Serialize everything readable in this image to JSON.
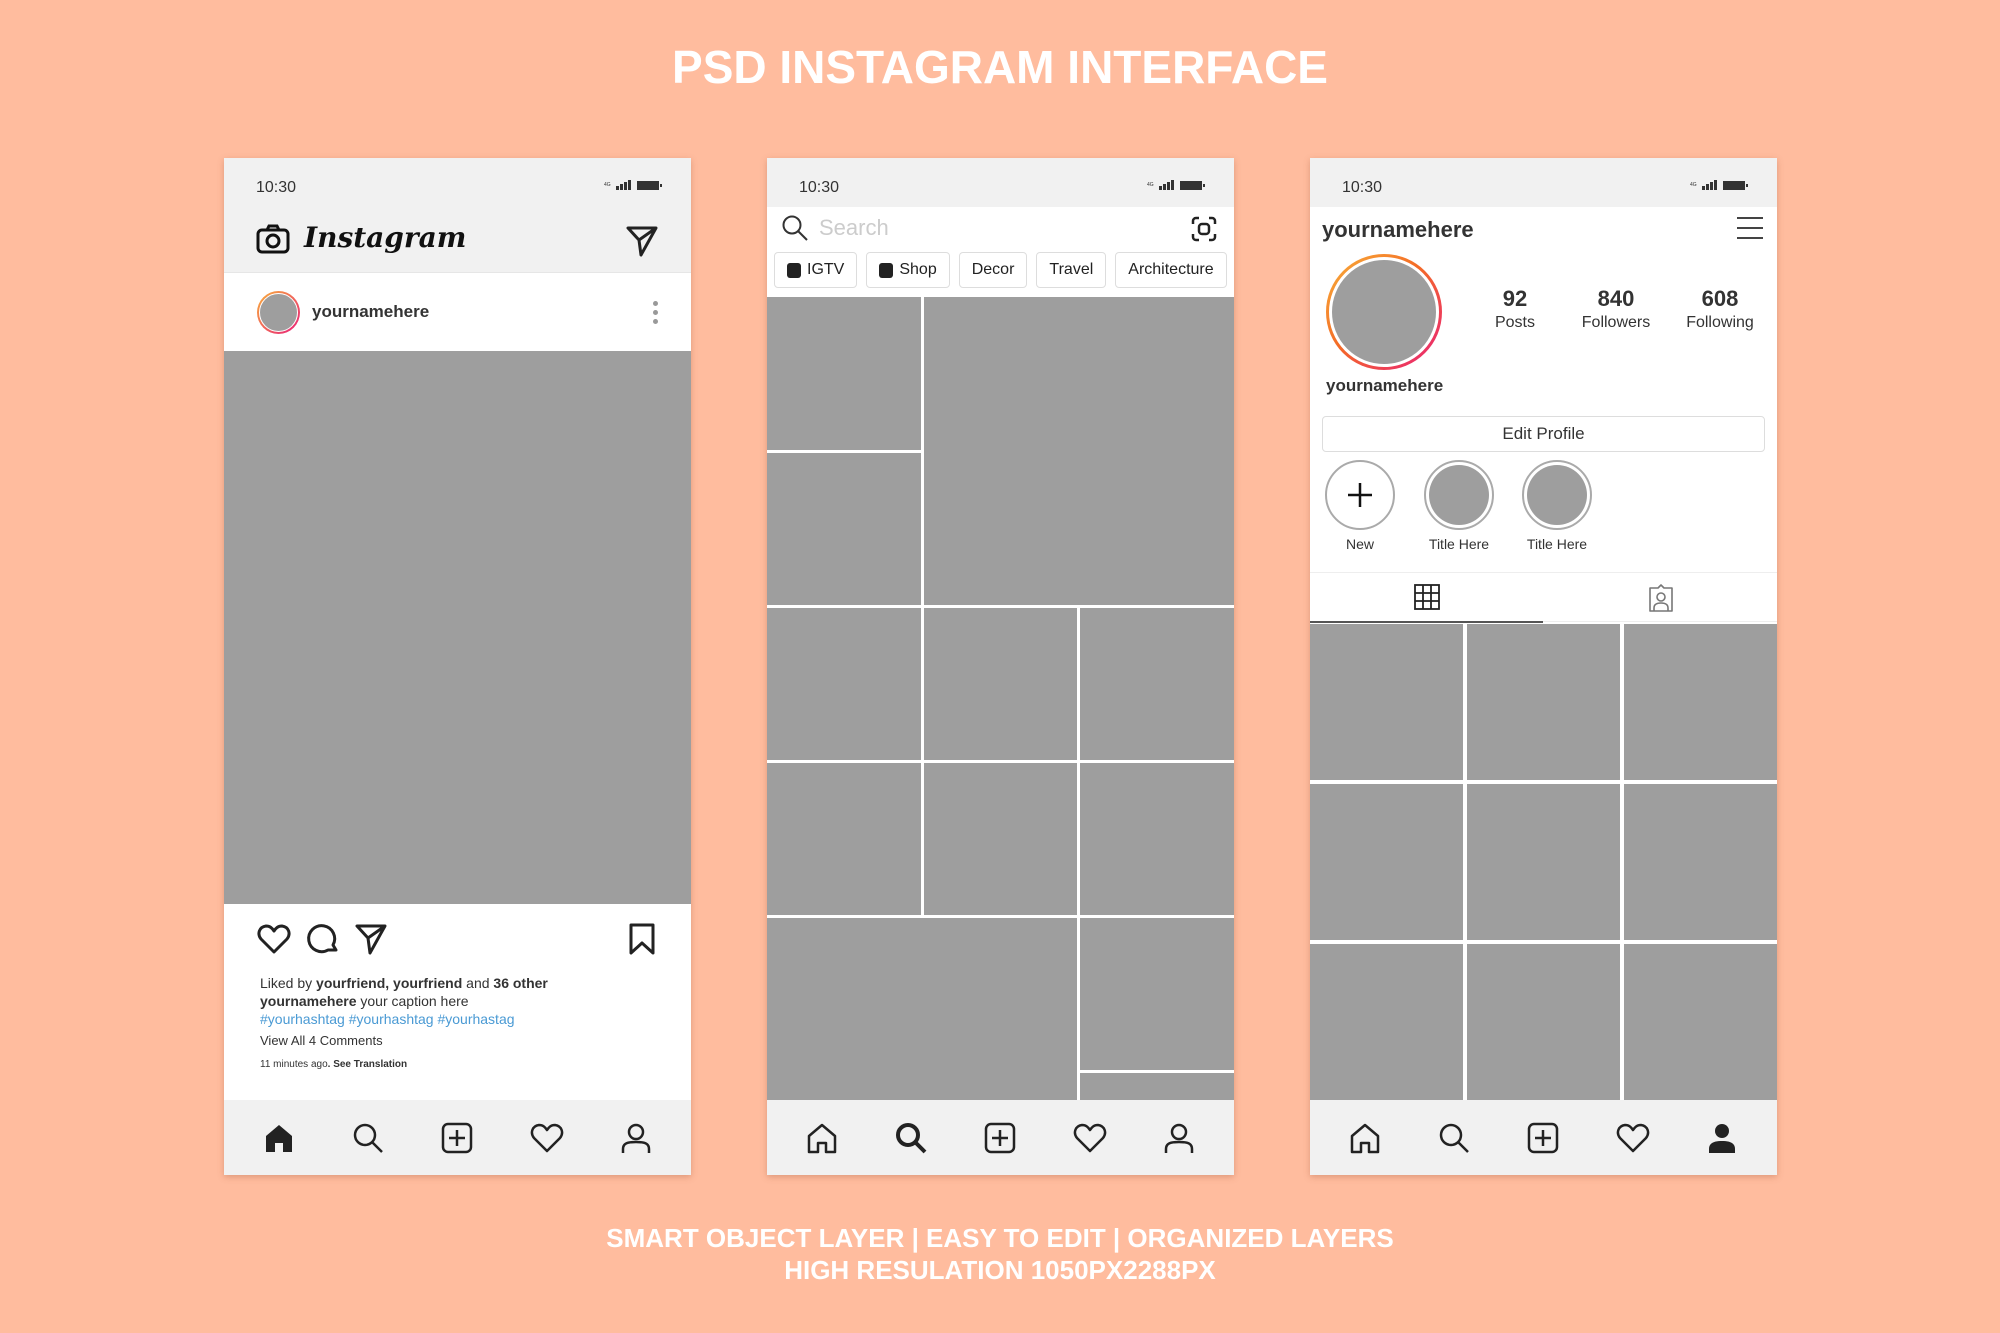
{
  "page": {
    "title": "PSD INSTAGRAM INTERFACE",
    "footer_line1": "SMART OBJECT LAYER | EASY TO EDIT | ORGANIZED LAYERS",
    "footer_line2": "HIGH RESULATION 1050PX2288PX",
    "background_color": "#ffbc9e",
    "placeholder_color": "#9e9e9e",
    "hashtag_color": "#4a9ad4"
  },
  "status_bar": {
    "time": "10:30",
    "network": "4G",
    "icons": [
      "signal-icon",
      "battery-icon"
    ]
  },
  "feed": {
    "logo": "Instagram",
    "header_icons": [
      "camera-icon",
      "direct-message-icon"
    ],
    "post": {
      "username": "yournamehere",
      "liked_prefix": "Liked by ",
      "liked_users": "yourfriend, yourfriend",
      "liked_and": " and ",
      "liked_count": "36 other",
      "caption_user": "yournamehere",
      "caption_text": " your caption here",
      "hashtags": "#yourhashtag #yourhashtag #yourhastag",
      "view_comments": "View All 4 Comments",
      "time_ago": "11 minutes ago",
      "see_translation": ". See Translation"
    }
  },
  "explore": {
    "search_placeholder": "Search",
    "chips": [
      {
        "label": "IGTV",
        "icon": "igtv-icon"
      },
      {
        "label": "Shop",
        "icon": "shop-bag-icon"
      },
      {
        "label": "Decor"
      },
      {
        "label": "Travel"
      },
      {
        "label": "Architecture"
      }
    ]
  },
  "profile": {
    "username": "yournamehere",
    "display_name": "yournamehere",
    "stats": [
      {
        "value": "92",
        "label": "Posts"
      },
      {
        "value": "840",
        "label": "Followers"
      },
      {
        "value": "608",
        "label": "Following"
      }
    ],
    "edit_button": "Edit Profile",
    "highlights": [
      {
        "label": "New"
      },
      {
        "label": "Title Here"
      },
      {
        "label": "Title Here"
      }
    ],
    "tabs": [
      "grid-icon",
      "tagged-icon"
    ],
    "active_tab": 0
  },
  "nav": {
    "items": [
      "home",
      "search",
      "add",
      "activity",
      "profile"
    ],
    "active": {
      "feed": "home",
      "explore": "search",
      "profile": "profile"
    }
  }
}
